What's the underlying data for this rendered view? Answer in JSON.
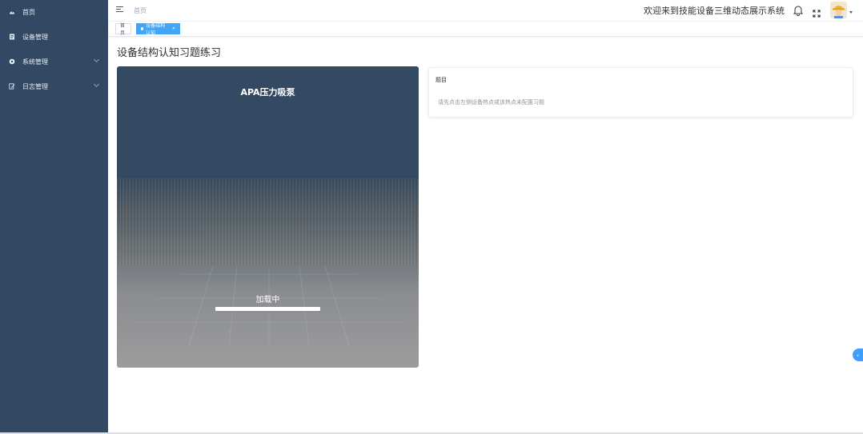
{
  "colors": {
    "sidebar_bg": "#334963",
    "accent": "#42a5f5",
    "scene_top": "#344a63"
  },
  "sidebar": {
    "items": [
      {
        "label": "首页",
        "icon": "dashboard-icon",
        "expandable": false
      },
      {
        "label": "设备管理",
        "icon": "document-icon",
        "expandable": false
      },
      {
        "label": "系统管理",
        "icon": "gear-icon",
        "expandable": true
      },
      {
        "label": "日志管理",
        "icon": "edit-log-icon",
        "expandable": true
      }
    ]
  },
  "header": {
    "breadcrumb": "首页",
    "welcome": "欢迎来到技能设备三维动态展示系统"
  },
  "tags": {
    "home": "首页",
    "active": "设备结构认知"
  },
  "main": {
    "page_title": "设备结构认知习题练习",
    "scene": {
      "title": "APA压力吸泵",
      "loading_text": "加载中",
      "progress": 1.0
    },
    "topic": {
      "heading": "题目",
      "hint": "请先点击左侧设备热点或该热点未配置习题"
    }
  }
}
